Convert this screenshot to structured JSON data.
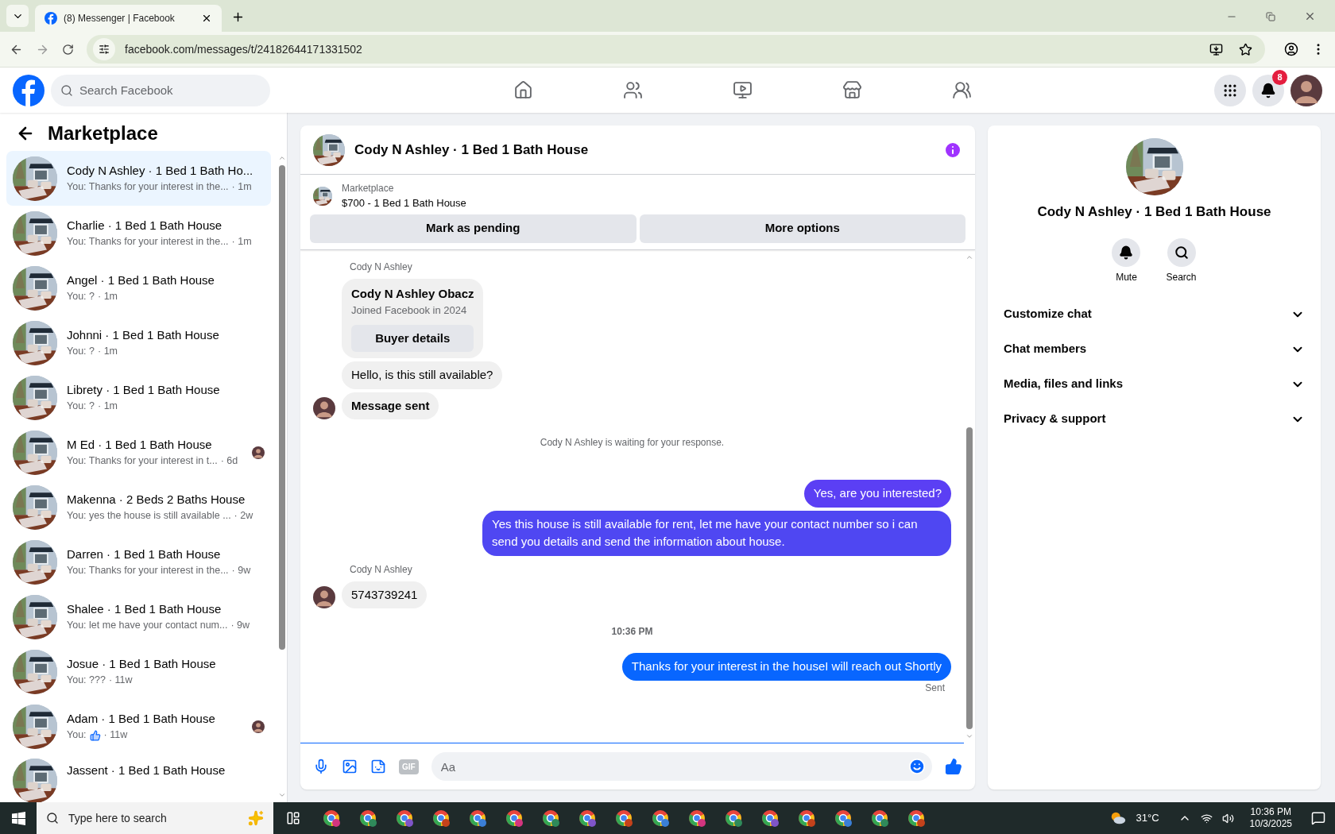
{
  "browser": {
    "tab_title": "(8) Messenger | Facebook",
    "url": "facebook.com/messages/t/24182644171331502"
  },
  "header": {
    "search_placeholder": "Search Facebook",
    "nav": [
      {
        "selected": false
      },
      {
        "selected": false
      },
      {
        "selected": false
      },
      {
        "selected": false
      },
      {
        "selected": false
      }
    ],
    "notification_count": "8"
  },
  "sidebar": {
    "title": "Marketplace",
    "conversations": [
      {
        "title": "Cody N Ashley · 1 Bed 1 Bath Ho...",
        "preview": "You: Thanks for your interest in the...",
        "time": "· 1m",
        "selected": true,
        "seen": false,
        "like": false
      },
      {
        "title": "Charlie · 1 Bed 1 Bath House",
        "preview": "You: Thanks for your interest in the...",
        "time": "· 1m",
        "selected": false,
        "seen": false,
        "like": false
      },
      {
        "title": "Angel · 1 Bed 1 Bath House",
        "preview": "You: ?",
        "time": "· 1m",
        "selected": false,
        "seen": false,
        "like": false
      },
      {
        "title": "Johnni · 1 Bed 1 Bath House",
        "preview": "You: ?",
        "time": "· 1m",
        "selected": false,
        "seen": false,
        "like": false
      },
      {
        "title": "Librety · 1 Bed 1 Bath House",
        "preview": "You: ?",
        "time": "· 1m",
        "selected": false,
        "seen": false,
        "like": false
      },
      {
        "title": "M Ed · 1 Bed 1 Bath House",
        "preview": "You: Thanks for your interest in t...",
        "time": "· 6d",
        "selected": false,
        "seen": true,
        "like": false
      },
      {
        "title": "Makenna · 2 Beds 2 Baths House",
        "preview": "You: yes the house is still available ...",
        "time": "· 2w",
        "selected": false,
        "seen": false,
        "like": false
      },
      {
        "title": "Darren · 1 Bed 1 Bath House",
        "preview": "You: Thanks for your interest in the...",
        "time": "· 9w",
        "selected": false,
        "seen": false,
        "like": false
      },
      {
        "title": "Shalee · 1 Bed 1 Bath House",
        "preview": "You: let me have your contact num...",
        "time": "· 9w",
        "selected": false,
        "seen": false,
        "like": false
      },
      {
        "title": "Josue · 1 Bed 1 Bath House",
        "preview": "You: ???",
        "time": "· 11w",
        "selected": false,
        "seen": false,
        "like": false
      },
      {
        "title": "Adam · 1 Bed 1 Bath House",
        "preview": "You:",
        "time": "· 11w",
        "selected": false,
        "seen": true,
        "like": true
      },
      {
        "title": "Jassent · 1 Bed 1 Bath House",
        "selected": false,
        "seen": false,
        "like": false
      }
    ]
  },
  "chat": {
    "title": "Cody N Ashley · 1 Bed 1 Bath House",
    "listing": {
      "source": "Marketplace",
      "name": "$700 - 1 Bed 1 Bath House"
    },
    "actions": [
      "Mark as pending",
      "More options"
    ],
    "messages": [
      {
        "kind": "sender",
        "text": "Cody N Ashley"
      },
      {
        "kind": "card",
        "name": "Cody N Ashley Obacz",
        "sub": "Joined Facebook in 2024",
        "button": "Buyer details"
      },
      {
        "kind": "incoming",
        "text": "Hello, is this still available?",
        "avatar": false,
        "bold": false
      },
      {
        "kind": "incoming",
        "text": "Message sent",
        "avatar": true,
        "bold": true
      },
      {
        "kind": "notice",
        "text": "Cody N Ashley is waiting for your response."
      },
      {
        "kind": "outgoing",
        "text": "Yes, are you interested?",
        "color": "#5b3ff4"
      },
      {
        "kind": "outgoing",
        "text": "Yes this house is still available for rent, let me have your contact number so i can send you details and send the information about house.",
        "color": "#4f47f2"
      },
      {
        "kind": "sender",
        "text": "Cody N Ashley"
      },
      {
        "kind": "incoming",
        "text": "5743739241",
        "avatar": true,
        "bold": false
      },
      {
        "kind": "timestamp",
        "text": "10:36 PM"
      },
      {
        "kind": "outgoing",
        "text": "Thanks for your interest in the houseI will reach out Shortly",
        "color": "#0866ff"
      },
      {
        "kind": "status",
        "text": "Sent"
      }
    ],
    "composer": {
      "gif_label": "GIF",
      "placeholder": "Aa"
    }
  },
  "details": {
    "title": "Cody N Ashley · 1 Bed 1 Bath House",
    "actions": [
      "Mute",
      "Search"
    ],
    "sections": [
      {
        "label": "Customize chat",
        "expanded": false
      },
      {
        "label": "Chat members",
        "expanded": false
      },
      {
        "label": "Media, files and links",
        "expanded": false
      },
      {
        "label": "Privacy & support",
        "expanded": false
      }
    ]
  },
  "taskbar": {
    "search_placeholder": "Type here to search",
    "weather": "31°C",
    "time": "10:36 PM",
    "date": "10/3/2025"
  }
}
